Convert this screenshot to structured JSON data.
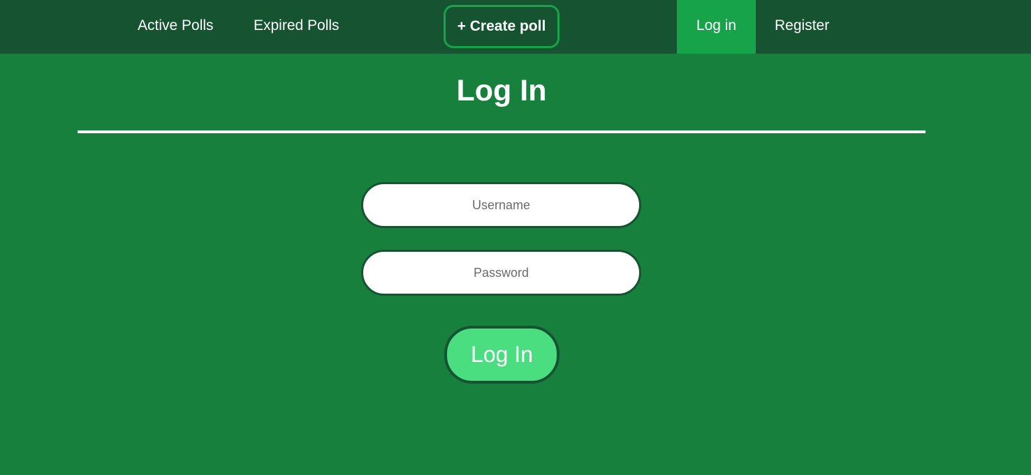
{
  "nav": {
    "active_polls": "Active Polls",
    "expired_polls": "Expired Polls",
    "create_poll": "+ Create poll",
    "log_in": "Log in",
    "register": "Register"
  },
  "main": {
    "title": "Log In",
    "username_placeholder": "Username",
    "password_placeholder": "Password",
    "submit_label": "Log In"
  },
  "colors": {
    "page_background": "#16803c",
    "nav_background": "#155331",
    "nav_active_background": "#16a34a",
    "create_poll_border": "#16a34a",
    "submit_button": "#4ade80"
  }
}
